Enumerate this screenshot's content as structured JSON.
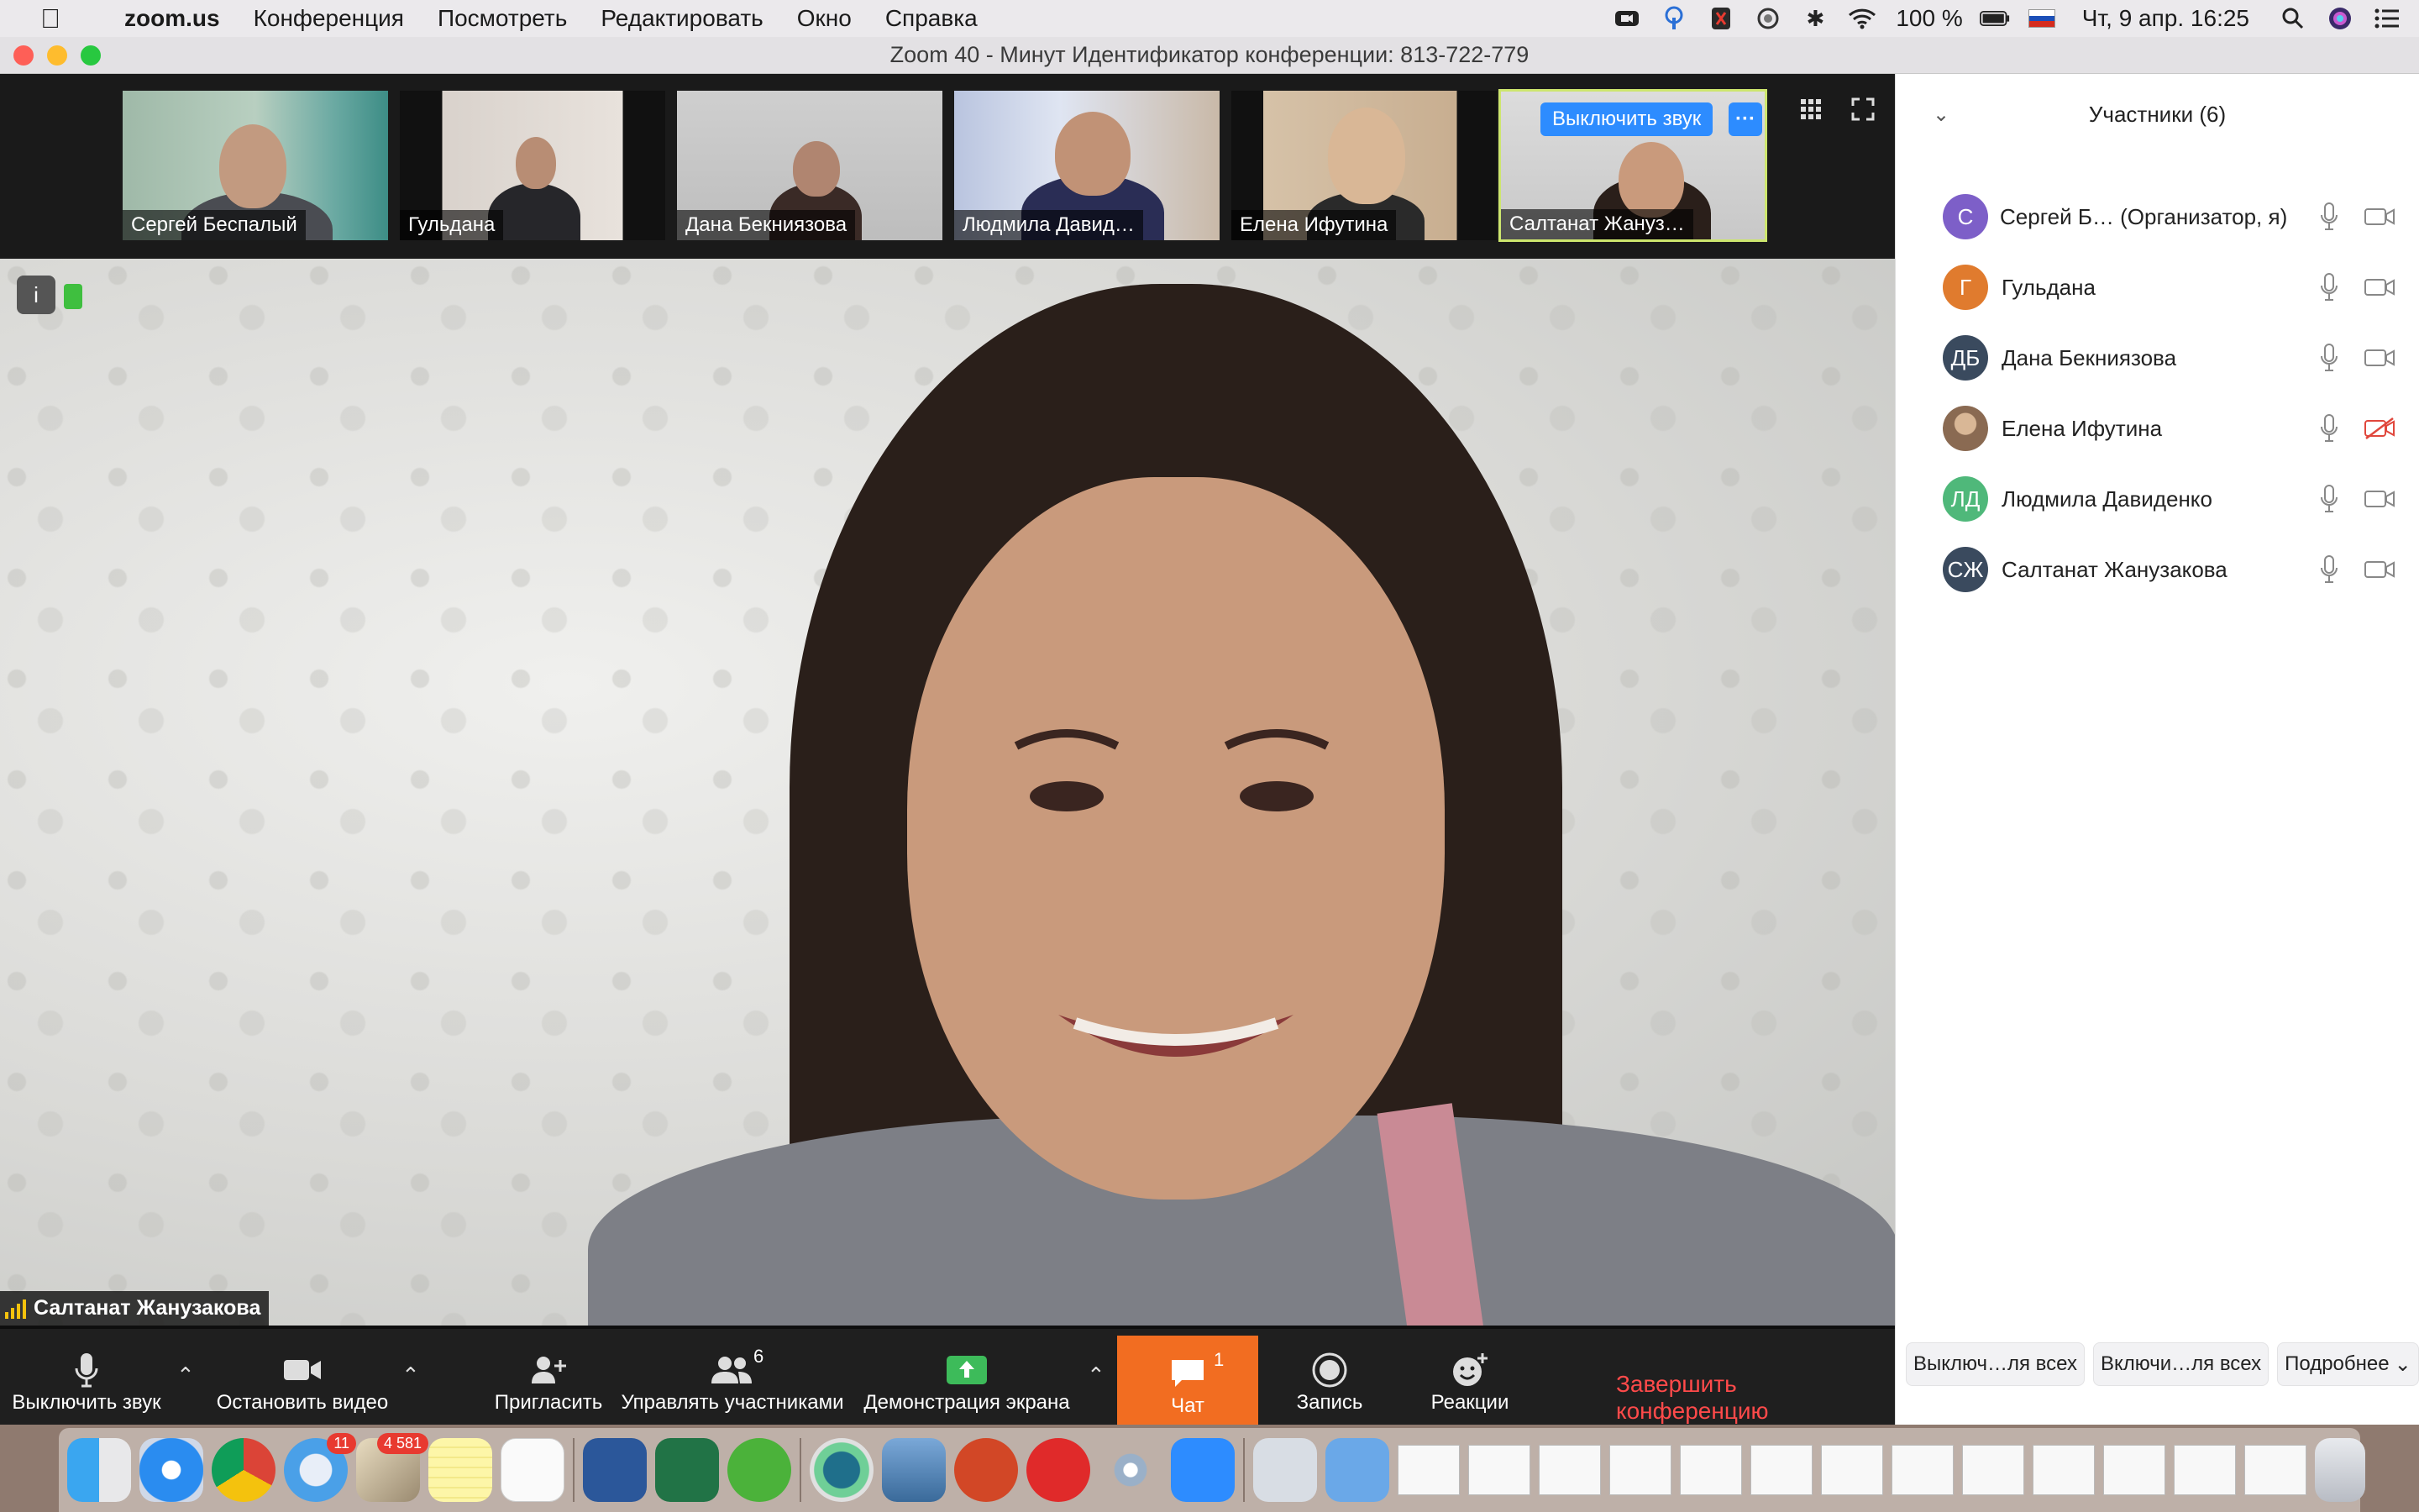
{
  "menubar": {
    "app_name": "zoom.us",
    "menus": [
      "Конференция",
      "Посмотреть",
      "Редактировать",
      "Окно",
      "Справка"
    ],
    "battery": "100 %",
    "datetime": "Чт, 9 апр.  16:25"
  },
  "window": {
    "title": "Zoom   40 - Минут  Идентификатор конференции: 813-722-779"
  },
  "gallery": {
    "tiles": [
      {
        "name": "Сергей Беспалый"
      },
      {
        "name": "Гульдана"
      },
      {
        "name": "Дана Бекниязова"
      },
      {
        "name": "Людмила Давид…"
      },
      {
        "name": "Елена Ифутина"
      },
      {
        "name": "Салтанат Жануз…"
      }
    ],
    "mute_button": "Выключить звук",
    "more_button": "···"
  },
  "main_video": {
    "speaker_name": "Салтанат Жанузакова"
  },
  "toolbar": {
    "mute": "Выключить звук",
    "stop_video": "Остановить видео",
    "invite": "Пригласить",
    "manage": "Управлять участниками",
    "manage_count": "6",
    "share": "Демонстрация экрана",
    "chat": "Чат",
    "chat_count": "1",
    "record": "Запись",
    "reactions": "Реакции",
    "end": "Завершить конференцию"
  },
  "participants": {
    "header": "Участники (6)",
    "list": [
      {
        "initials": "С",
        "name": "Сергей Б…   (Организатор, я)",
        "color": "#7d5fc8"
      },
      {
        "initials": "Г",
        "name": "Гульдана",
        "color": "#e07b2e"
      },
      {
        "initials": "ДБ",
        "name": "Дана Бекниязова",
        "color": "#3a4a5e"
      },
      {
        "initials": "",
        "name": "Елена Ифутина",
        "color": "#8a6a52"
      },
      {
        "initials": "ЛД",
        "name": "Людмила Давиденко",
        "color": "#4fb87a"
      },
      {
        "initials": "СЖ",
        "name": "Салтанат Жанузакова",
        "color": "#3a4a5e"
      }
    ],
    "footer": {
      "mute_all": "Выключ…ля всех",
      "unmute_all": "Включи…ля всех",
      "more": "Подробнее"
    }
  },
  "dock": {
    "mail_badge": "11",
    "other_badge": "4 581"
  }
}
